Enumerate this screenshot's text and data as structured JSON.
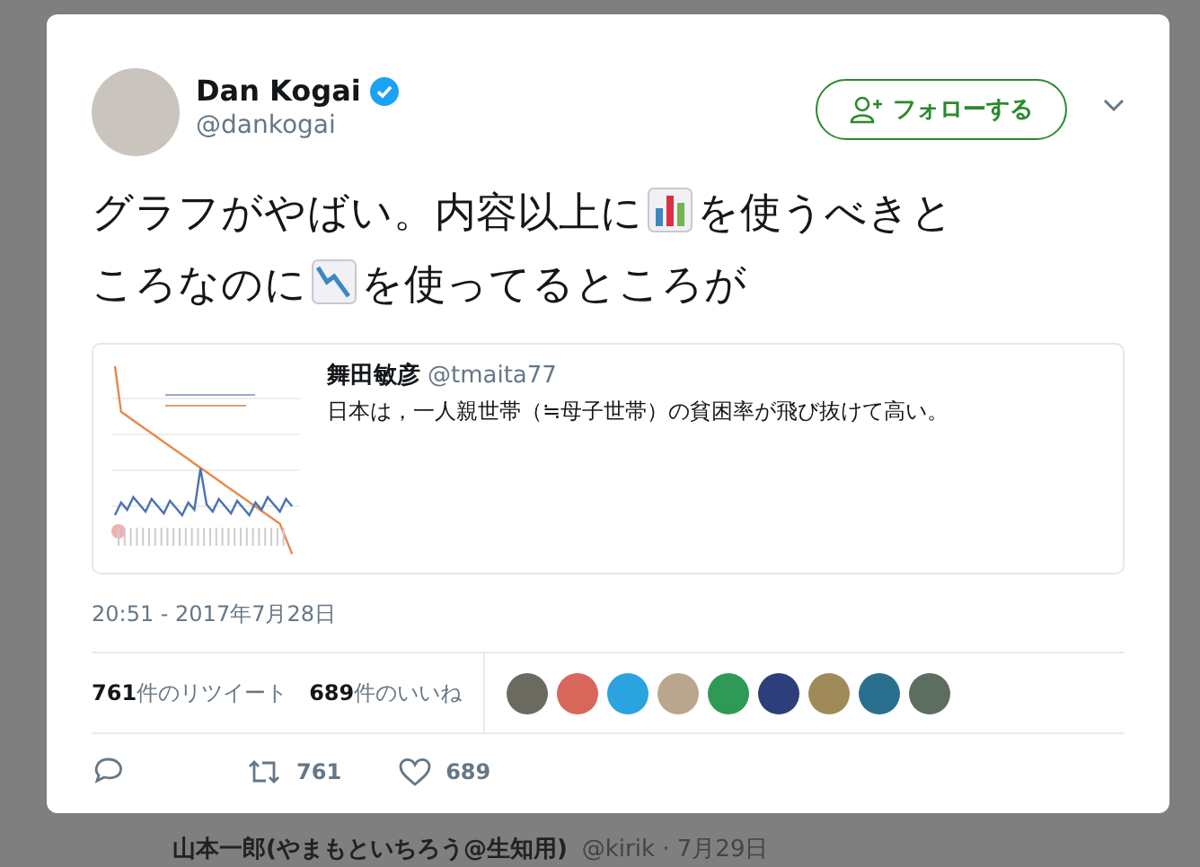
{
  "tweet": {
    "author": {
      "name": "Dan Kogai",
      "verified": true,
      "handle": "@dankogai"
    },
    "follow_button": "フォローする",
    "text_parts": [
      {
        "kind": "text",
        "text": "グラフがやばい。内容以上に"
      },
      {
        "kind": "bar-chart"
      },
      {
        "kind": "text",
        "text": "を使うべきところなのに"
      },
      {
        "kind": "chart-down"
      },
      {
        "kind": "text",
        "text": "を使ってるところが"
      }
    ],
    "quoted": {
      "name": "舞田敏彦",
      "handle": "@tmaita77",
      "text": "日本は，一人親世帯（≒母子世帯）の貧困率が飛び抜けて高い。"
    },
    "timestamp": "20:51 - 2017年7月28日",
    "stats": [
      {
        "count": "761",
        "label": "件のリツイート"
      },
      {
        "count": "689",
        "label": "件のいいね"
      }
    ],
    "liker_avatars": [
      {
        "color": "#6b6a60"
      },
      {
        "color": "#d8665a"
      },
      {
        "color": "#2aa3de"
      },
      {
        "color": "#b9a68c"
      },
      {
        "color": "#2f9a55"
      },
      {
        "color": "#2c3f7a"
      },
      {
        "color": "#a08a5a"
      },
      {
        "color": "#2b6f8f"
      },
      {
        "color": "#5d6e60"
      }
    ],
    "actions": {
      "retweets": "761",
      "likes": "689"
    }
  },
  "background_tweet_bottom": {
    "name": "山本一郎(やまもといちろう@生知用)",
    "meta": "@kirik · 7月29日"
  }
}
